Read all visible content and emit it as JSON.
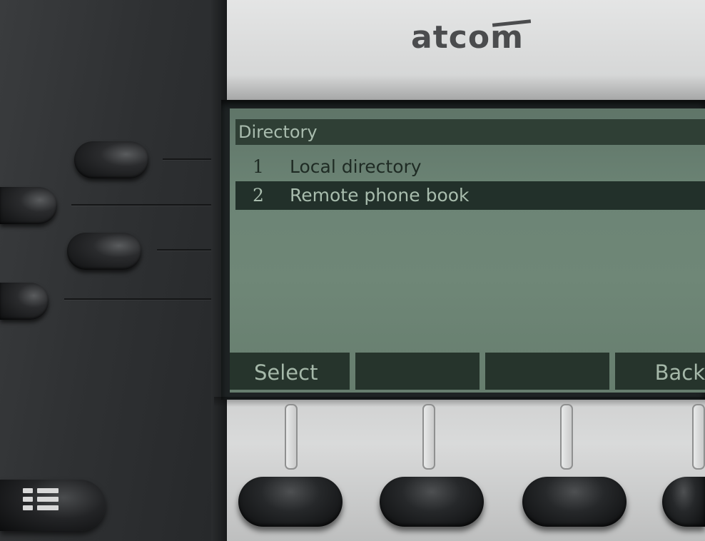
{
  "brand": {
    "logo_text": "atcom"
  },
  "screen": {
    "title": "Directory",
    "menu_items": [
      {
        "number": "1",
        "label": "Local directory",
        "selected": false
      },
      {
        "number": "2",
        "label": "Remote phone book",
        "selected": true
      }
    ],
    "softkeys": [
      {
        "label": "Select"
      },
      {
        "label": ""
      },
      {
        "label": ""
      },
      {
        "label": "Back"
      }
    ]
  },
  "colors": {
    "lcd_background": "#6f8777",
    "lcd_highlight": "#22302a",
    "lcd_text_dark": "#1f2b24",
    "lcd_text_light": "#a8bcad",
    "housing_silver": "#cfd0d0",
    "panel_dark": "#2f3133",
    "button_black": "#1a1b1c"
  },
  "icons": {
    "menu_key": "menu-list-icon"
  }
}
